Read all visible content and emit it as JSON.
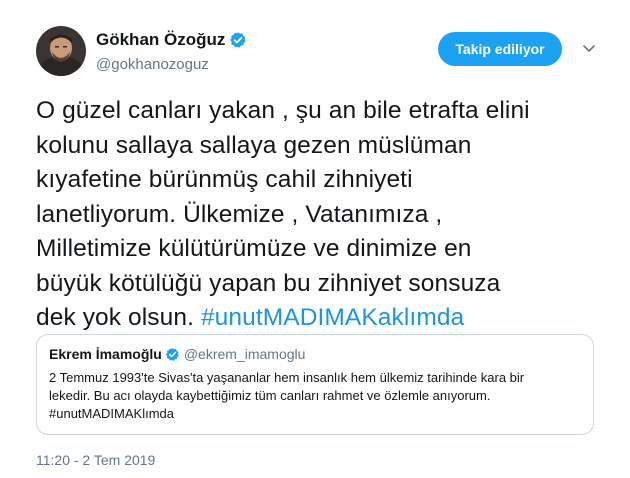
{
  "author": {
    "name": "Gökhan Özoğuz",
    "handle": "@gokhanozoguz",
    "verified": true
  },
  "follow_button_label": "Takip ediliyor",
  "tweet_text_lines": [
    "O güzel canları yakan , şu an bile etrafta elini",
    "kolunu sallaya sallaya gezen müslüman",
    "kıyafetine bürünmüş cahil zihniyeti",
    "lanetliyorum. Ülkemize , Vatanımıza ,",
    "Milletimize külütürümüze ve dinimize en",
    "büyük kötülüğü yapan bu zihniyet sonsuza",
    "dek yok olsun. "
  ],
  "tweet_hashtag": "#unutMADIMAKaklımda",
  "quoted_tweet": {
    "name": "Ekrem İmamoğlu",
    "handle": "@ekrem_imamoglu",
    "verified": true,
    "text_lines": [
      "2 Temmuz 1993'te Sivas'ta yaşananlar hem insanlık hem ülkemiz tarihinde kara bir",
      "lekedir. Bu acı olayda kaybettiğimiz tüm canları rahmet ve özlemle anıyorum.",
      "#unutMADIMAKlımda"
    ]
  },
  "timestamp": "11:20 - 2 Tem 2019",
  "colors": {
    "accent": "#1da1f2",
    "link": "#1b95e0",
    "secondary_text": "#657786",
    "border": "#ccd6dd"
  },
  "icons": [
    "verified-badge-icon",
    "chevron-down-icon"
  ]
}
